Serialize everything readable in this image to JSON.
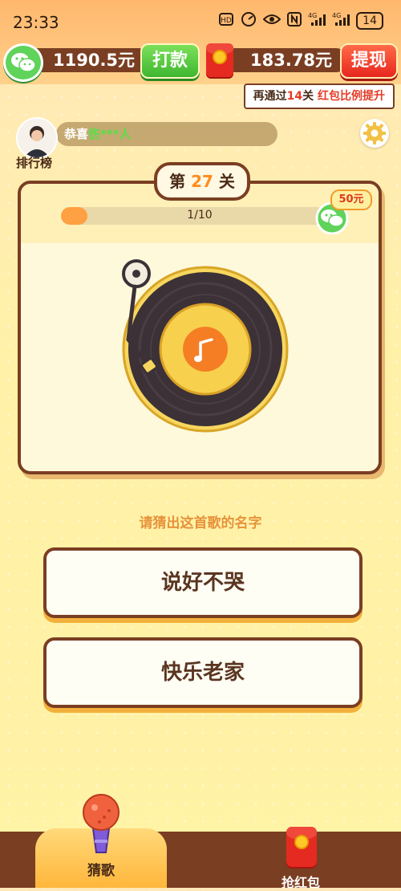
{
  "status_bar": {
    "time": "23:33",
    "icons": [
      "hd-icon",
      "speed-icon",
      "eye-icon",
      "nfc-icon",
      "signal-4g-icon",
      "signal-4g-icon"
    ],
    "battery": "14"
  },
  "top_bar": {
    "balance": "1190.5元",
    "payout_button": "打款",
    "redpack_balance": "183.78元",
    "withdraw_button": "提现",
    "tip_prefix": "再通过",
    "tip_count": "14",
    "tip_middle": "关",
    "tip_suffix": "红包比例提升"
  },
  "leaderboard": {
    "congrats": "恭喜",
    "name": "伤***人",
    "label": "排行榜"
  },
  "level": {
    "prefix": "第",
    "number": "27",
    "suffix": "关",
    "progress_text": "1/10",
    "progress_fraction": 0.1,
    "reward": "50元"
  },
  "question": "请猜出这首歌的名字",
  "answers": [
    "说好不哭",
    "快乐老家"
  ],
  "bottom_nav": {
    "tab_guess": "猜歌",
    "tab_redpack": "抢红包"
  },
  "colors": {
    "brown": "#7a3e22",
    "orange": "#ffa042",
    "green": "#3fb630",
    "red": "#e7271e",
    "background": "#fff3a6"
  }
}
